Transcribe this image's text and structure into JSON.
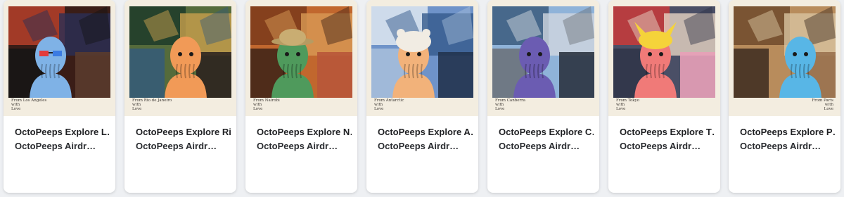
{
  "colors": {
    "page_bg": "#eef0f3",
    "card_bg": "#ffffff",
    "text": "#202124"
  },
  "cards": [
    {
      "title": "OctoPeeps Explore L…",
      "subtitle": "OctoPeeps Airdr…",
      "caption": "From Los Angeles\nwith\nLove",
      "octopus_color": "#7fb2e6",
      "hat": "3d-glasses",
      "palette": [
        "#3a1d17",
        "#b5402a",
        "#2b2f56",
        "#151515",
        "#5a3b2c"
      ]
    },
    {
      "title": "OctoPeeps Explore Rio",
      "subtitle": "OctoPeeps Airdr…",
      "caption": "From Rio de Janeiro\nwith\nLove",
      "octopus_color": "#f19a57",
      "hat": "none",
      "palette": [
        "#556b3b",
        "#1e3b2a",
        "#c9a04e",
        "#355a7a",
        "#2d2520"
      ]
    },
    {
      "title": "OctoPeeps Explore N…",
      "subtitle": "OctoPeeps Airdr…",
      "caption": "From Nairobi\nwith\nLove",
      "octopus_color": "#4f9a5c",
      "hat": "safari-hat",
      "palette": [
        "#c1672e",
        "#7a3a1a",
        "#d89a55",
        "#3b2216",
        "#b8563a"
      ]
    },
    {
      "title": "OctoPeeps Explore A…",
      "subtitle": "OctoPeeps Airdr…",
      "caption": "From Antarctic\nwith\nLove",
      "octopus_color": "#f2b27a",
      "hat": "bear-hood",
      "palette": [
        "#6f93c9",
        "#dfe7f1",
        "#345a8c",
        "#a9c0dc",
        "#22344f"
      ]
    },
    {
      "title": "OctoPeeps Explore C…",
      "subtitle": "OctoPeeps Airdr…",
      "caption": "From Canberra\nwith\nLove",
      "octopus_color": "#6b5cb2",
      "hat": "none",
      "palette": [
        "#8fb3d9",
        "#3b5a7d",
        "#d0d6de",
        "#6a6f76",
        "#2b3340"
      ]
    },
    {
      "title": "OctoPeeps Explore T…",
      "subtitle": "OctoPeeps Airdr…",
      "caption": "From Tokyo\nwith\nLove",
      "octopus_color": "#f07a78",
      "hat": "pikachu-hat",
      "palette": [
        "#4a4f66",
        "#c93a3a",
        "#e6d3c3",
        "#2f3448",
        "#e8a0b8"
      ]
    },
    {
      "title": "OctoPeeps Explore P…",
      "subtitle": "OctoPeeps Airdr…",
      "caption": "From Paris\nwith\nLove",
      "octopus_color": "#58b6e6",
      "hat": "none",
      "palette": [
        "#b88c5c",
        "#6e4a2c",
        "#d8c3a0",
        "#3b2a1e",
        "#9a7250"
      ]
    }
  ]
}
